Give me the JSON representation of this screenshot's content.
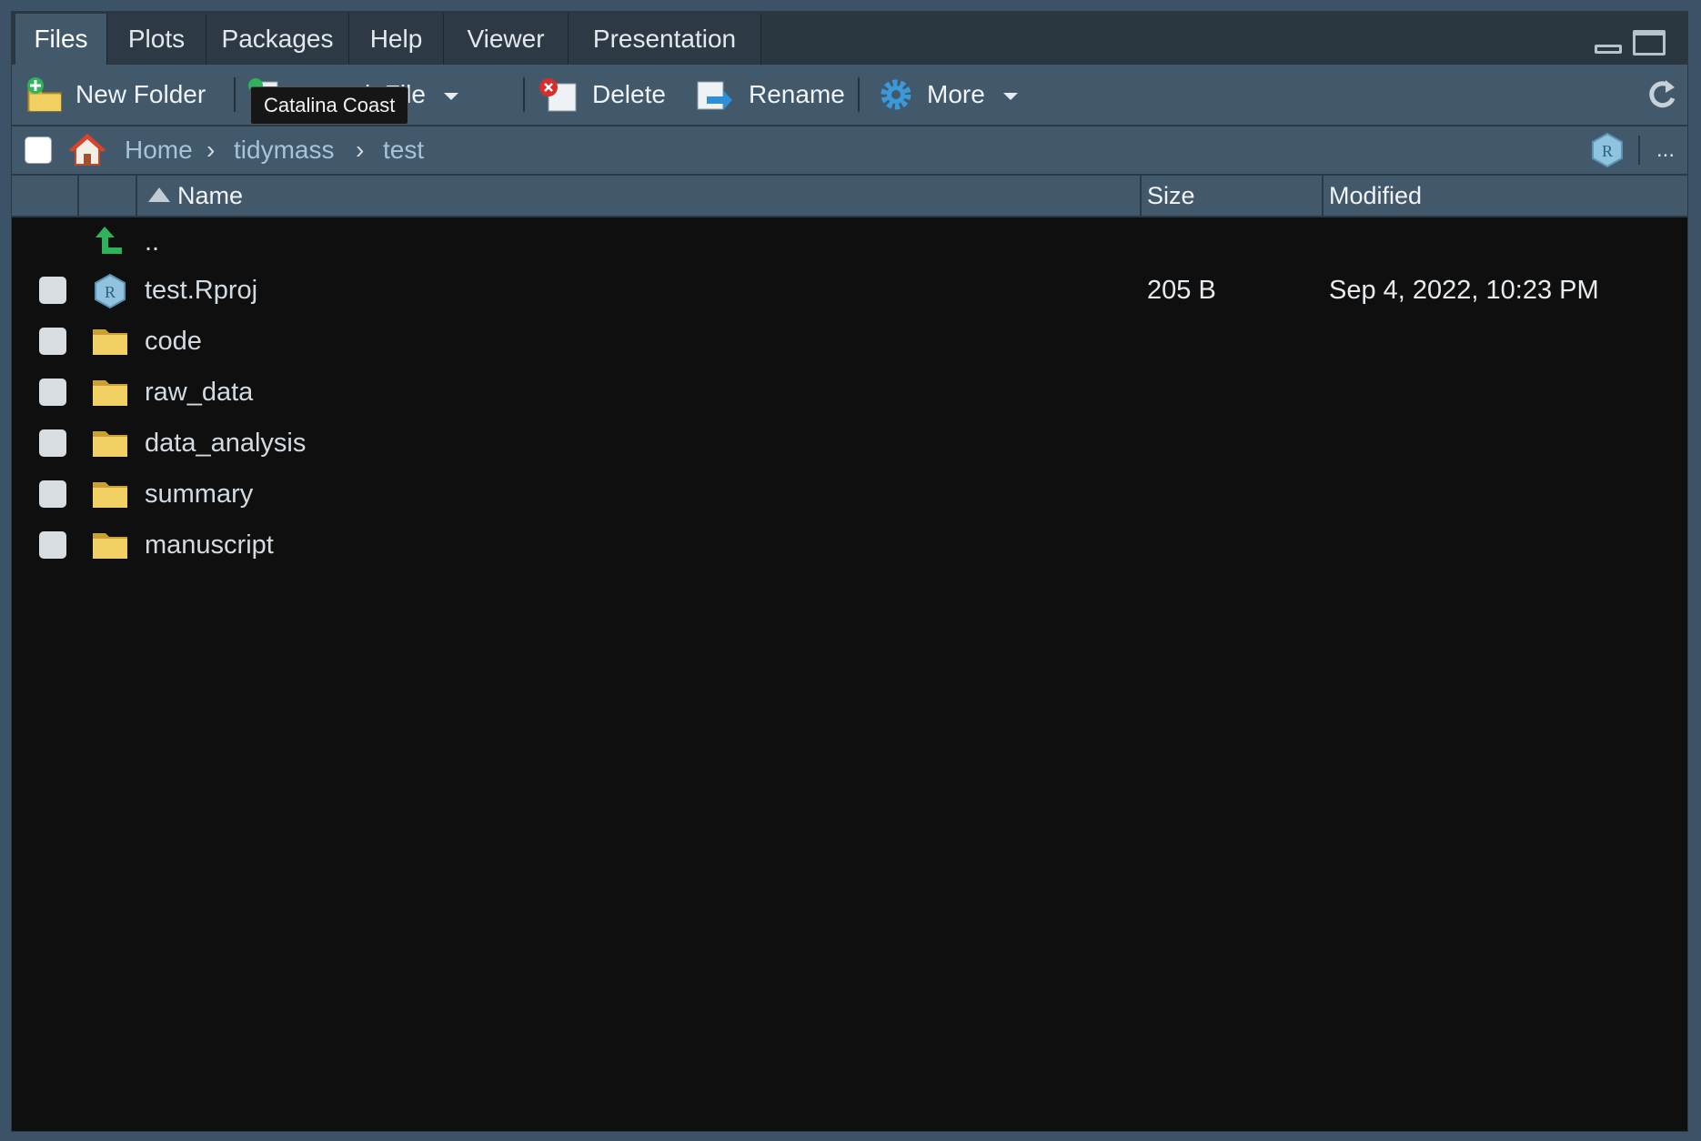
{
  "tabs": [
    {
      "label": "Files",
      "active": true
    },
    {
      "label": "Plots"
    },
    {
      "label": "Packages"
    },
    {
      "label": "Help"
    },
    {
      "label": "Viewer"
    },
    {
      "label": "Presentation"
    }
  ],
  "toolbar": {
    "new_folder": "New Folder",
    "new_blank_file_visible": "k File",
    "delete": "Delete",
    "rename": "Rename",
    "more": "More"
  },
  "tooltip": "Catalina Coast",
  "breadcrumb": [
    "Home",
    "tidymass",
    "test"
  ],
  "breadcrumb_more": "...",
  "columns": {
    "name": "Name",
    "size": "Size",
    "modified": "Modified"
  },
  "parent_dir": "..",
  "files": [
    {
      "name": "test.Rproj",
      "type": "rproj",
      "size": "205 B",
      "modified": "Sep 4, 2022, 10:23 PM"
    },
    {
      "name": "code",
      "type": "folder",
      "size": "",
      "modified": ""
    },
    {
      "name": "raw_data",
      "type": "folder",
      "size": "",
      "modified": ""
    },
    {
      "name": "data_analysis",
      "type": "folder",
      "size": "",
      "modified": ""
    },
    {
      "name": "summary",
      "type": "folder",
      "size": "",
      "modified": ""
    },
    {
      "name": "manuscript",
      "type": "folder",
      "size": "",
      "modified": ""
    }
  ],
  "colors": {
    "pane_bg": "#0f0f0f",
    "toolbar_bg": "#42586b",
    "link": "#a9c2d6"
  }
}
